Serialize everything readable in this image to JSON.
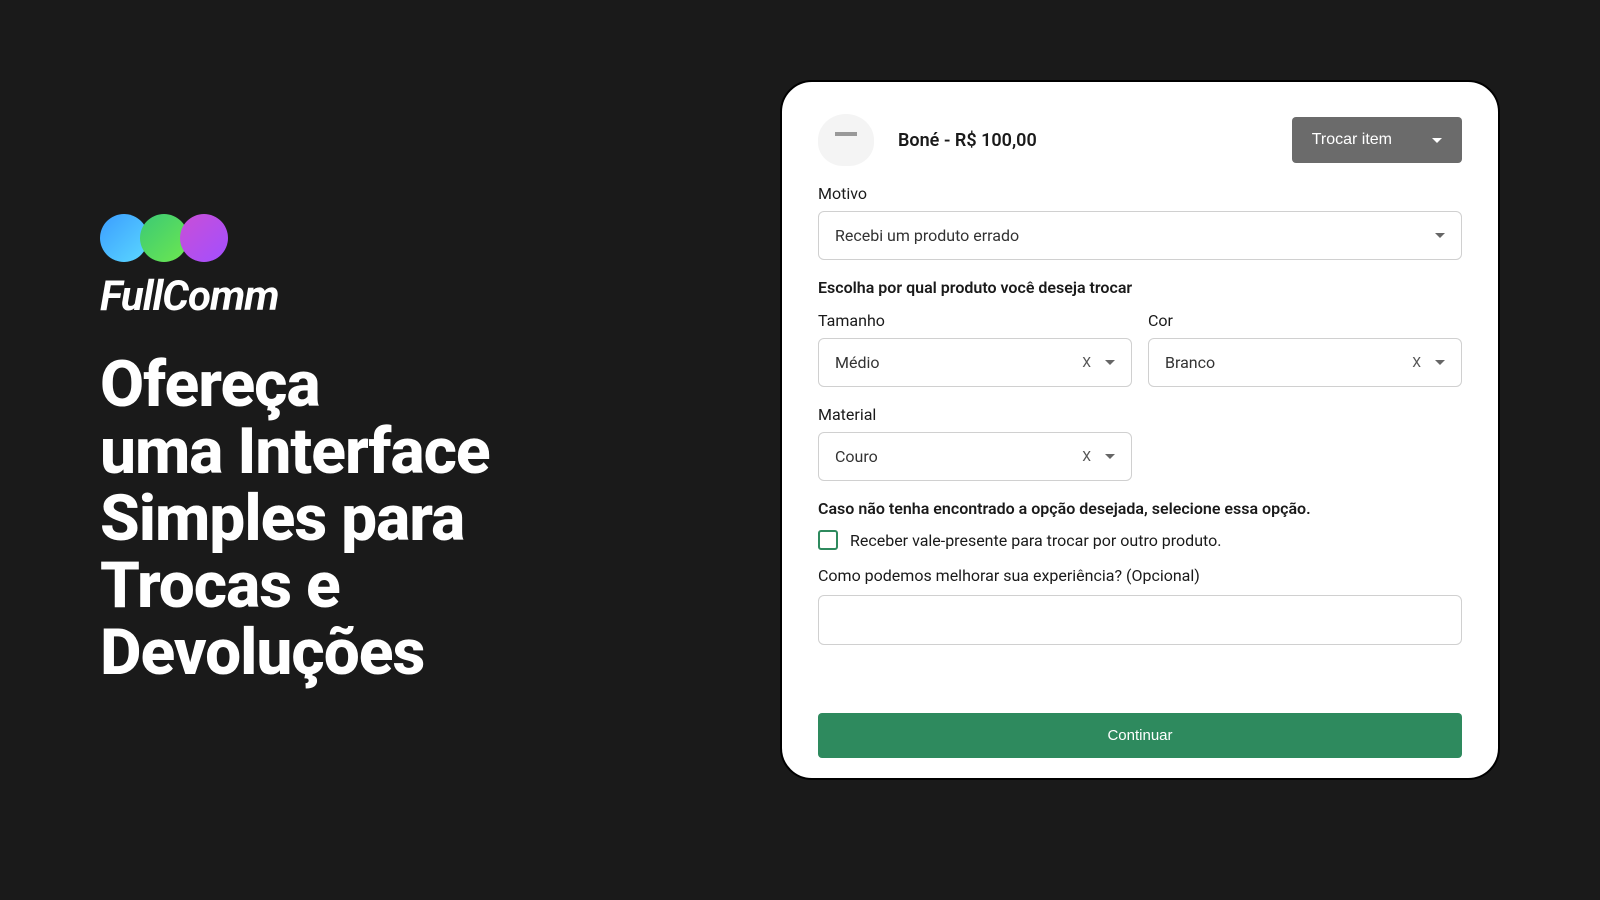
{
  "brand": {
    "name": "FullComm"
  },
  "hero": {
    "line1": "Ofereça",
    "line2": "uma Interface",
    "line3": "Simples para",
    "line4": "Trocas e",
    "line5": "Devoluções"
  },
  "product": {
    "title": "Boné - R$ 100,00"
  },
  "action_dropdown": {
    "label": "Trocar item"
  },
  "form": {
    "motivo_label": "Motivo",
    "motivo_value": "Recebi um produto errado",
    "escolha_label": "Escolha por qual produto você deseja trocar",
    "tamanho_label": "Tamanho",
    "tamanho_value": "Médio",
    "cor_label": "Cor",
    "cor_value": "Branco",
    "material_label": "Material",
    "material_value": "Couro",
    "fallback_label": "Caso não tenha encontrado a opção desejada, selecione essa opção.",
    "checkbox_label": "Receber vale-presente para trocar por outro produto.",
    "feedback_label": "Como podemos melhorar sua experiência? (Opcional)",
    "clear_symbol": "X"
  },
  "buttons": {
    "continue": "Continuar"
  }
}
